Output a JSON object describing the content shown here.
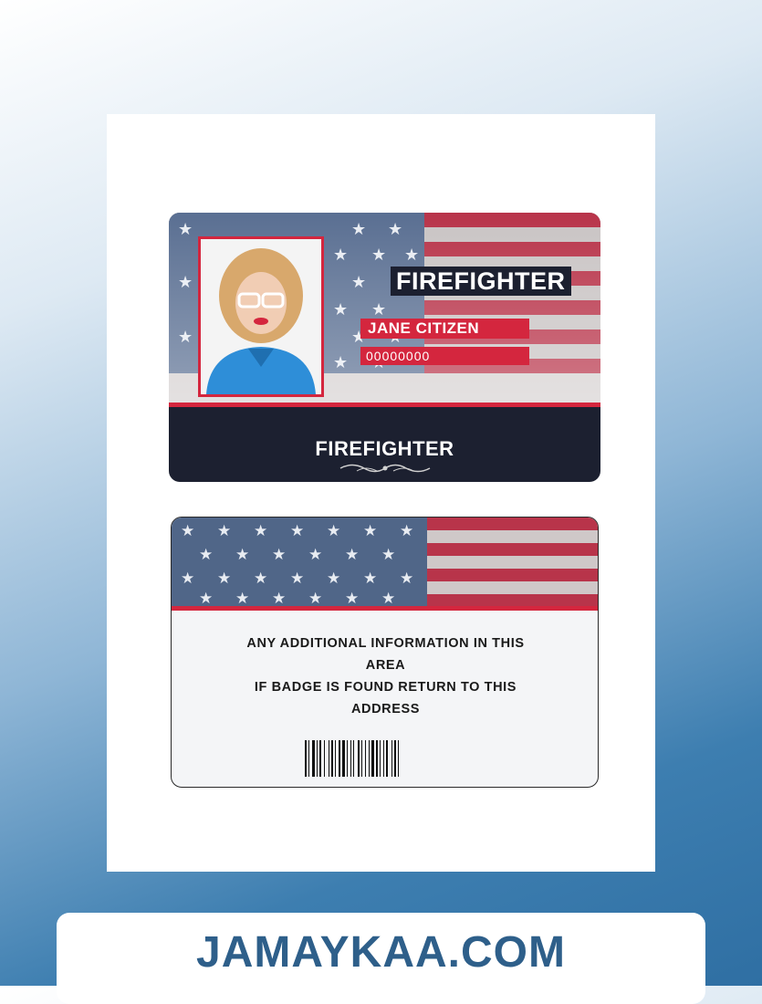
{
  "front": {
    "title": "FIREFIGHTER",
    "name": "JANE CITIZEN",
    "id_number": "00000000",
    "bottom_title": "FIREFIGHTER"
  },
  "back": {
    "info_line1": "ANY ADDITIONAL INFORMATION IN THIS",
    "info_line2": "AREA",
    "info_line3": "IF BADGE IS FOUND RETURN TO THIS",
    "info_line4": "ADDRESS"
  },
  "brand": "JAMAYKAA.COM",
  "colors": {
    "accent_red": "#d4263e",
    "navy": "#1c2030",
    "brand_blue": "#2e5f8a"
  }
}
